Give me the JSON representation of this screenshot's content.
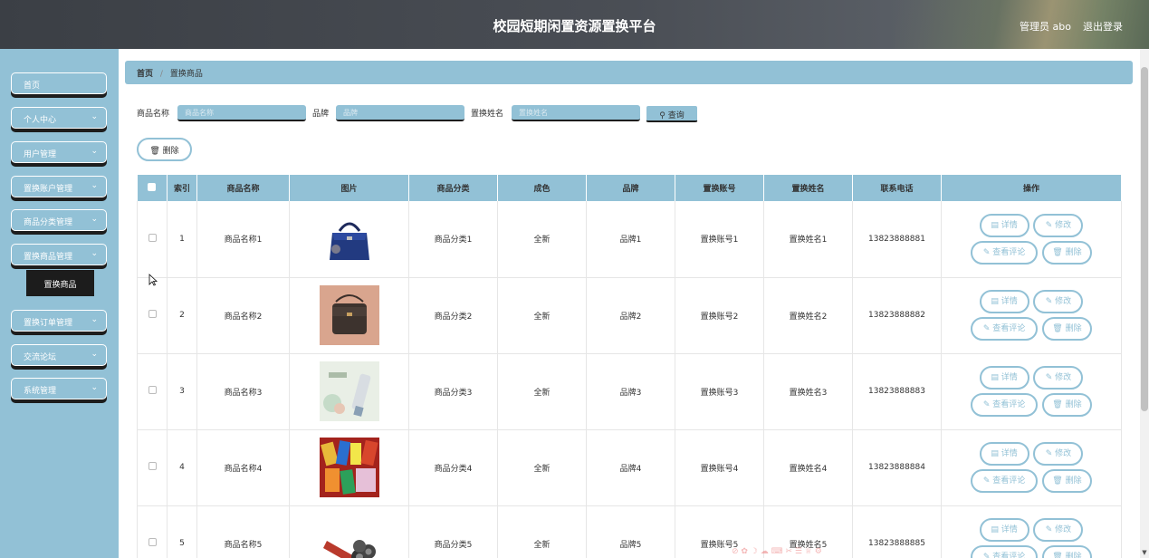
{
  "header": {
    "title": "校园短期闲置资源置换平台",
    "admin": "管理员 abo",
    "logout": "退出登录"
  },
  "sidebar": {
    "items": [
      {
        "label": "首页",
        "chevron": false
      },
      {
        "label": "个人中心",
        "chevron": true
      },
      {
        "label": "用户管理",
        "chevron": true
      },
      {
        "label": "置换账户管理",
        "chevron": true
      },
      {
        "label": "商品分类管理",
        "chevron": true
      },
      {
        "label": "置换商品管理",
        "chevron": true
      },
      {
        "label": "置换订单管理",
        "chevron": true
      },
      {
        "label": "交流论坛",
        "chevron": true
      },
      {
        "label": "系统管理",
        "chevron": true
      }
    ],
    "sub_item": "置换商品"
  },
  "breadcrumb": {
    "home": "首页",
    "current": "置换商品"
  },
  "search": {
    "name_label": "商品名称",
    "name_placeholder": "商品名称",
    "brand_label": "品牌",
    "brand_placeholder": "品牌",
    "swapper_label": "置换姓名",
    "swapper_placeholder": "置换姓名",
    "query_label": "查询"
  },
  "delete_label": "删除",
  "table": {
    "headers": [
      "索引",
      "商品名称",
      "图片",
      "商品分类",
      "成色",
      "品牌",
      "置换账号",
      "置换姓名",
      "联系电话",
      "操作"
    ],
    "rows": [
      {
        "index": "1",
        "name": "商品名称1",
        "image": "handbag-navy",
        "category": "商品分类1",
        "condition": "全新",
        "brand": "品牌1",
        "account": "置换账号1",
        "swapper": "置换姓名1",
        "phone": "13823888881"
      },
      {
        "index": "2",
        "name": "商品名称2",
        "image": "crossbody-bag",
        "category": "商品分类2",
        "condition": "全新",
        "brand": "品牌2",
        "account": "置换账号2",
        "swapper": "置换姓名2",
        "phone": "13823888882"
      },
      {
        "index": "3",
        "name": "商品名称3",
        "image": "cream-tube",
        "category": "商品分类3",
        "condition": "全新",
        "brand": "品牌3",
        "account": "置换账号3",
        "swapper": "置换姓名3",
        "phone": "13823888883"
      },
      {
        "index": "4",
        "name": "商品名称4",
        "image": "snacks",
        "category": "商品分类4",
        "condition": "全新",
        "brand": "品牌4",
        "account": "置换账号4",
        "swapper": "置换姓名4",
        "phone": "13823888884"
      },
      {
        "index": "5",
        "name": "商品名称5",
        "image": "shaver",
        "category": "商品分类5",
        "condition": "全新",
        "brand": "品牌5",
        "account": "置换账号5",
        "swapper": "置换姓名5",
        "phone": "13823888885"
      }
    ],
    "actions": {
      "detail": "详情",
      "edit": "修改",
      "comment": "查看评论",
      "delete": "删除"
    }
  },
  "colors": {
    "accent": "#92c1d6",
    "header": "#44484e",
    "shadow": "#1d1d1d"
  }
}
